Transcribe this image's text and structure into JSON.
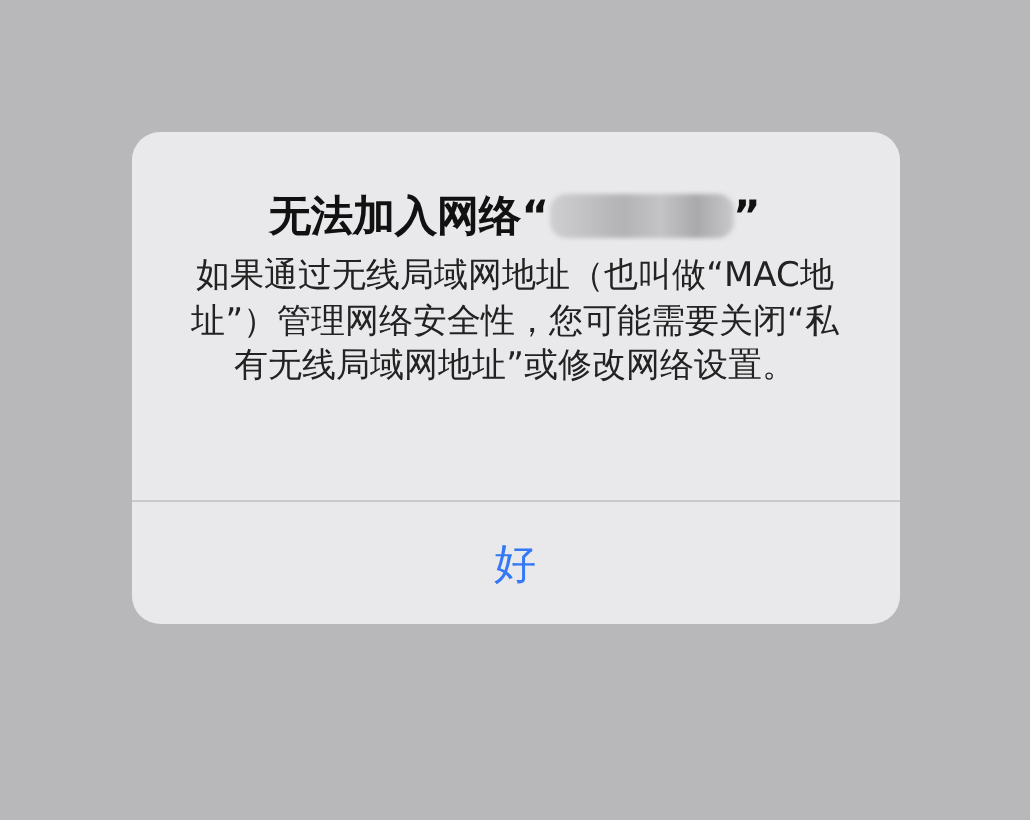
{
  "alert": {
    "title": {
      "before": "无法加入网络“",
      "after": "”",
      "redacted": true
    },
    "message": "如果通过无线局域网地址（也叫做“MAC地址”）管理网络安全性，您可能需要关闭“私有无线局域网地址”或修改网络设置。",
    "buttons": [
      {
        "label": "好"
      }
    ]
  }
}
